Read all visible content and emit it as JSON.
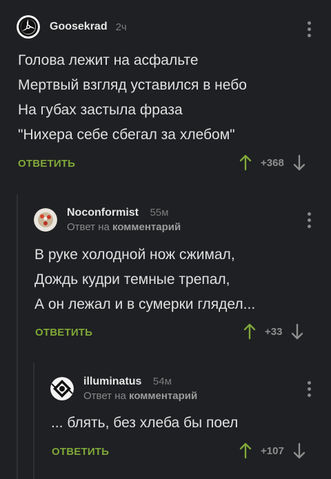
{
  "comments": [
    {
      "author": "Goosekrad",
      "time": "2ч",
      "text": "Голова лежит на асфальте\nМертвый взгляд уставился в небо\nНа губах застыла фраза\n\"Нихера себе сбегал за хлебом\"",
      "reply_label": "ответить",
      "score": "+368"
    },
    {
      "author": "Noconformist",
      "time": "55м",
      "reply_to_prefix": "Ответ на",
      "reply_to_link": "комментарий",
      "text": "В руке холодной нож сжимал,\nДождь кудри темные трепал,\nА он лежал и в сумерки глядел...",
      "reply_label": "ответить",
      "score": "+33"
    },
    {
      "author": "illuminatus",
      "time": "54м",
      "reply_to_prefix": "Ответ на",
      "reply_to_link": "комментарий",
      "text": "... блять, без хлеба бы поел",
      "reply_label": "ответить",
      "score": "+107"
    }
  ],
  "colors": {
    "background": "#1f2023",
    "reply_green": "#7fa838",
    "upvote_green": "#7fa838",
    "muted": "#8a8a8a"
  },
  "icons": [
    "menu-dots-icon",
    "upvote-arrow-icon",
    "downvote-arrow-icon"
  ]
}
